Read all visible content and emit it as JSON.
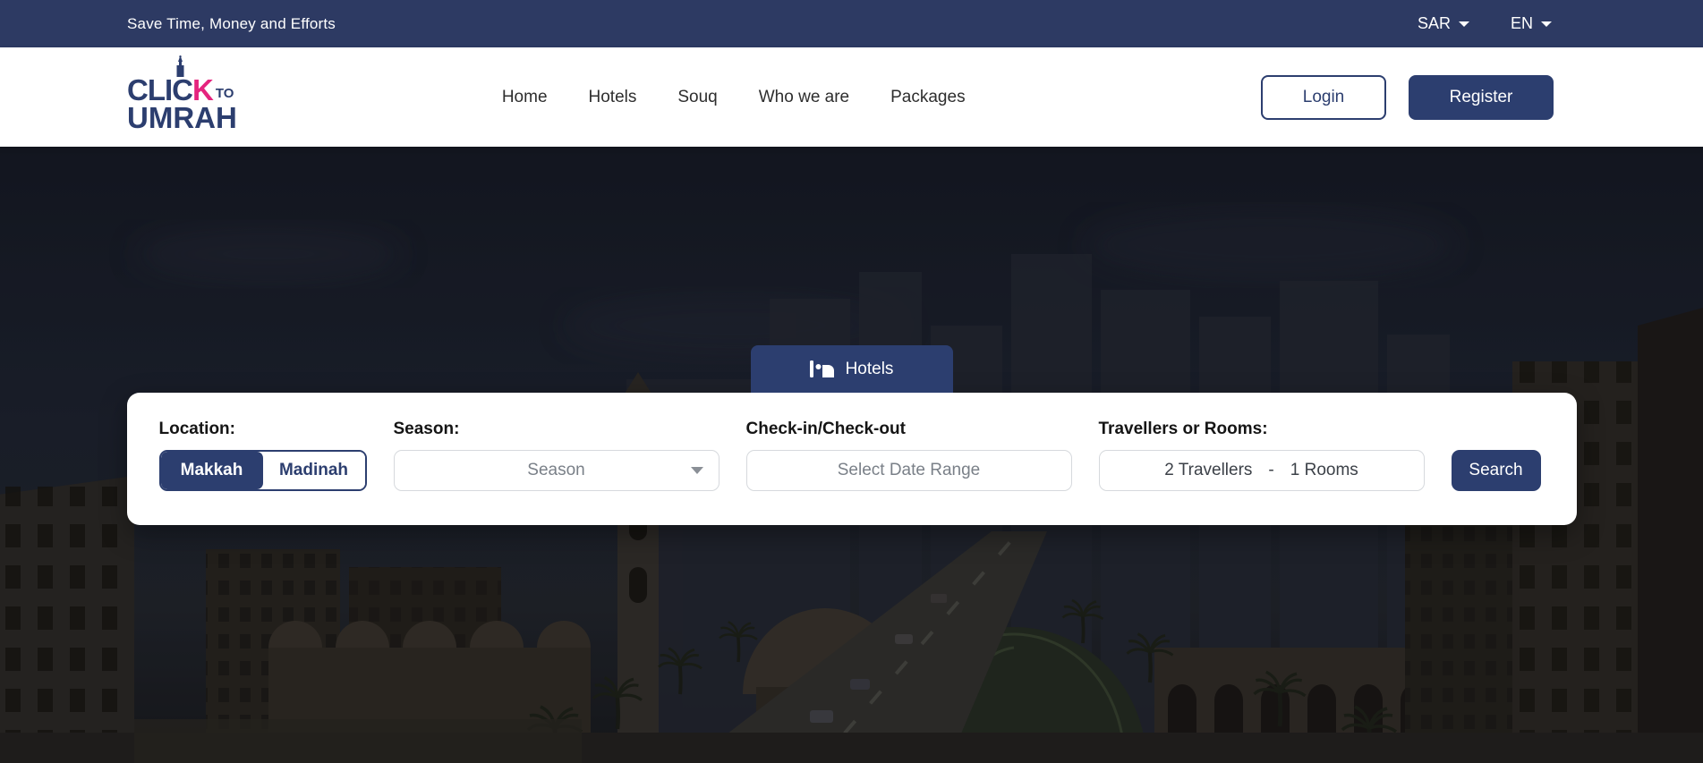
{
  "topbar": {
    "tagline": "Save Time, Money and Efforts",
    "currency_label": "SAR",
    "language_label": "EN"
  },
  "header": {
    "logo": {
      "clic": "CLIC",
      "k": "K",
      "to": "TO",
      "umrah": "UMRAH"
    },
    "nav": [
      {
        "label": "Home"
      },
      {
        "label": "Hotels"
      },
      {
        "label": "Souq"
      },
      {
        "label": "Who we are"
      },
      {
        "label": "Packages"
      }
    ],
    "login_label": "Login",
    "register_label": "Register"
  },
  "hero": {
    "tab_label": "Hotels",
    "search_panel": {
      "location": {
        "label": "Location:",
        "selected": "Makkah",
        "options": [
          "Makkah",
          "Madinah"
        ]
      },
      "season": {
        "label": "Season:",
        "placeholder": "Season"
      },
      "dates": {
        "label": "Check-in/Check-out",
        "placeholder": "Select Date Range"
      },
      "travellers": {
        "label": "Travellers or Rooms:",
        "travellers_value": "2 Travellers",
        "separator": "-",
        "rooms_value": "1 Rooms"
      },
      "search_label": "Search"
    }
  },
  "colors": {
    "primary": "#2c3e6f",
    "topbar_bg": "#2d3a63",
    "accent_pink": "#e5247e"
  }
}
